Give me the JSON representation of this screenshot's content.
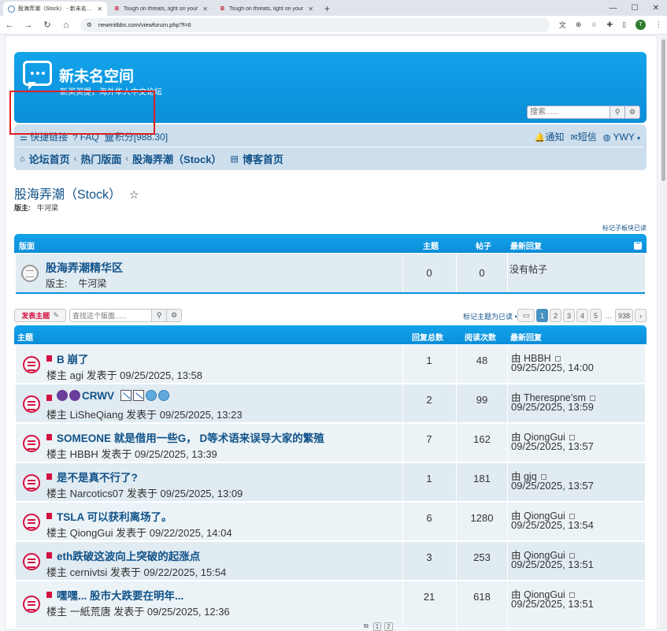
{
  "browser": {
    "tabs": [
      {
        "title": "股海弄潮（Stock） - 新未名空间",
        "icon": "globe-icon"
      },
      {
        "title": "Tough on threats, light on your",
        "icon": "b-logo-icon"
      },
      {
        "title": "Tough on threats, light on your",
        "icon": "b-logo-icon"
      }
    ],
    "url": "newmitbbs.com/viewforum.php?f=6",
    "profile_initial": "T"
  },
  "site": {
    "title": "新未名空间",
    "description": "新买买提，海外华人中文论坛",
    "search_placeholder": "搜索......"
  },
  "navbar": {
    "quicklinks": "快捷链接",
    "faq": "FAQ",
    "points": "积分[988.30]",
    "notifications": "通知",
    "messages": "短信",
    "username": "YWY",
    "breadcrumbs": [
      "论坛首页",
      "热门版面",
      "股海弄潮（Stock）"
    ],
    "blog": "博客首页"
  },
  "page": {
    "title": "股海弄潮（Stock）",
    "moderator_label": "版主:",
    "moderator": "牛河梁",
    "mark_subforums": "标记子板块已读"
  },
  "forum_table": {
    "headers": {
      "forum": "版面",
      "topics": "主题",
      "posts": "帖子",
      "last": "最新回复"
    },
    "row": {
      "title": "股海弄潮精华区",
      "moderator_label": "版主:",
      "moderator": "牛河梁",
      "topics": "0",
      "posts": "0",
      "last": "没有帖子"
    }
  },
  "actions": {
    "new_topic": "发表主题",
    "search_placeholder": "查找这个版面......",
    "mark_read": "标记主题为已读 •",
    "pages": [
      "1",
      "2",
      "3",
      "4",
      "5"
    ],
    "last_page": "938",
    "ellipsis": "…"
  },
  "topics_table": {
    "headers": {
      "topic": "主题",
      "replies": "回复总数",
      "views": "阅读次数",
      "last": "最新回复"
    },
    "rows": [
      {
        "title": "B 崩了",
        "meta": "楼主 agi 发表于 09/25/2025, 13:58",
        "replies": "1",
        "views": "48",
        "last_by": "由 HBBH",
        "last_time": "09/25/2025, 14:00"
      },
      {
        "title": "CRWV",
        "meta": "楼主 LiSheQiang 发表于 09/25/2025, 13:23",
        "replies": "2",
        "views": "99",
        "last_by": "由 Therespne’sm",
        "last_time": "09/25/2025, 13:59"
      },
      {
        "title": "SOMEONE 就是借用一些G， D等术语来误导大家的繁殖",
        "meta": "楼主 HBBH 发表于 09/25/2025, 13:39",
        "replies": "7",
        "views": "162",
        "last_by": "由 QiongGui",
        "last_time": "09/25/2025, 13:57"
      },
      {
        "title": "是不是真不行了?",
        "meta": "楼主 Narcotics07 发表于 09/25/2025, 13:09",
        "replies": "1",
        "views": "181",
        "last_by": "由 gjq",
        "last_time": "09/25/2025, 13:57"
      },
      {
        "title": "TSLA 可以获利离场了。",
        "meta": "楼主 QiongGui 发表于 09/22/2025, 14:04",
        "replies": "6",
        "views": "1280",
        "last_by": "由 QiongGui",
        "last_time": "09/25/2025, 13:54"
      },
      {
        "title": "eth跌破这波向上突破的起涨点",
        "meta": "楼主 cernivtsi 发表于 09/22/2025, 15:54",
        "replies": "3",
        "views": "253",
        "last_by": "由 QiongGui",
        "last_time": "09/25/2025, 13:51"
      },
      {
        "title": "嘿嘿... 股市大跌要在明年...",
        "meta": "楼主 一紙荒唐 发表于 09/25/2025, 12:36",
        "replies": "21",
        "views": "618",
        "last_by": "由 QiongGui",
        "last_time": "09/25/2025, 13:51"
      }
    ],
    "mini_pages": [
      "1",
      "2"
    ]
  }
}
